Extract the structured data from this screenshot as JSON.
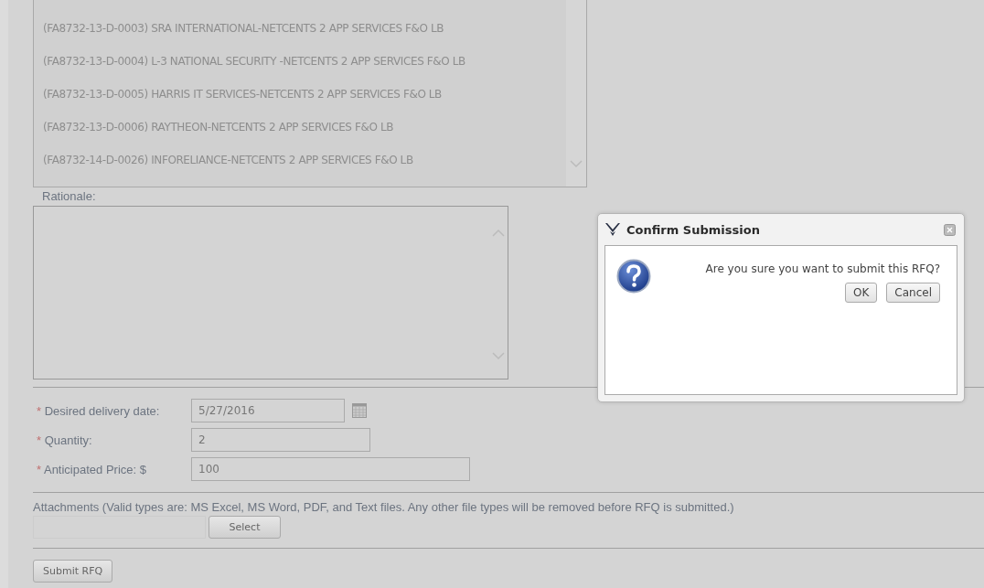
{
  "contract_list": {
    "items": [
      {
        "label": "(FA8732-13-D-0003) SRA INTERNATIONAL-NETCENTS 2 APP SERVICES F&O LB"
      },
      {
        "label": "(FA8732-13-D-0004) L-3 NATIONAL SECURITY -NETCENTS 2 APP SERVICES F&O LB"
      },
      {
        "label": "(FA8732-13-D-0005) HARRIS IT SERVICES-NETCENTS 2 APP SERVICES F&O LB"
      },
      {
        "label": "(FA8732-13-D-0006) RAYTHEON-NETCENTS 2 APP SERVICES F&O LB"
      },
      {
        "label": "(FA8732-14-D-0026) INFORELIANCE-NETCENTS 2 APP SERVICES F&O LB"
      }
    ]
  },
  "rationale": {
    "label": "Rationale:"
  },
  "fields": [
    {
      "kind": "date",
      "marker": "*",
      "label": "Desired delivery date:",
      "value": "5/27/2016"
    },
    {
      "kind": "text",
      "marker": "*",
      "label": "Quantity:",
      "value": "2"
    },
    {
      "kind": "wide",
      "marker": "*",
      "label": "Anticipated Price: $",
      "value": "100"
    }
  ],
  "attachments": {
    "label": "Attachments (Valid types are: MS Excel, MS Word, PDF, and Text files. Any other file types will be removed before RFQ is submitted.)",
    "button": "Select"
  },
  "submit_button": "Submit RFQ",
  "dialog": {
    "title": "Confirm Submission",
    "message": "Are you sure you want to submit this RFQ?",
    "buttons": [
      "OK",
      "Cancel"
    ]
  }
}
